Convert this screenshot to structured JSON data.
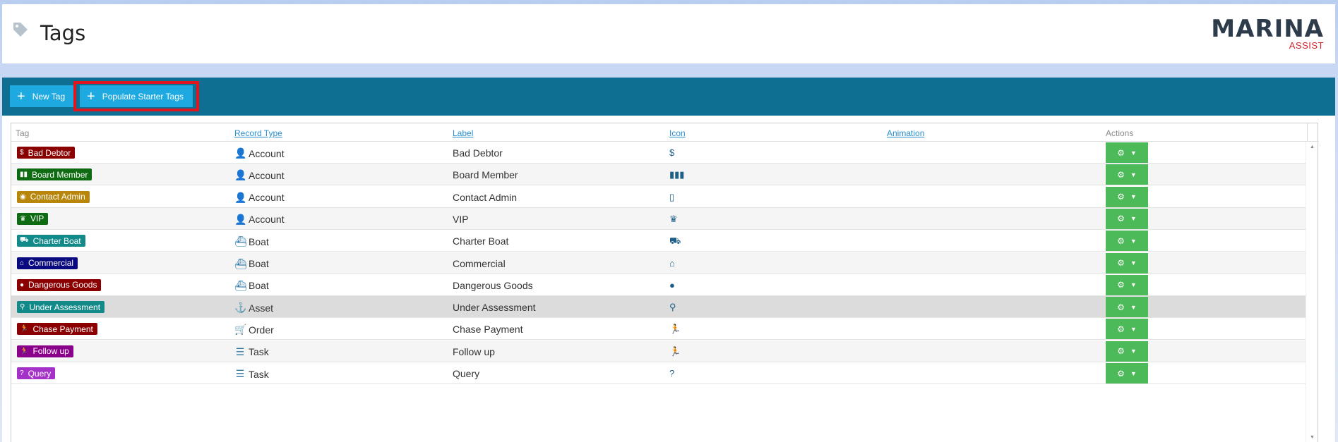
{
  "page": {
    "title": "Tags"
  },
  "logo": {
    "line1": "MARINA",
    "line2": "ASSIST"
  },
  "toolbar": {
    "new_tag_label": "New Tag",
    "populate_label": "Populate Starter Tags"
  },
  "table": {
    "columns": [
      "Tag",
      "Record Type",
      "Label",
      "Icon",
      "Animation",
      "Actions"
    ],
    "rows": [
      {
        "tag": "Bad Debtor",
        "tag_color": "#8b0000",
        "tag_icon": "hand-money-icon",
        "record_type": "Account",
        "record_icon": "user-icon",
        "label": "Bad Debtor",
        "icon_glyph": "$",
        "selected": false
      },
      {
        "tag": "Board Member",
        "tag_color": "#0e6b12",
        "tag_icon": "boardroom-icon",
        "record_type": "Account",
        "record_icon": "user-icon",
        "label": "Board Member",
        "icon_glyph": "▮▮▮",
        "selected": false
      },
      {
        "tag": "Contact Admin",
        "tag_color": "#b8860b",
        "tag_icon": "phone-icon",
        "record_type": "Account",
        "record_icon": "user-icon",
        "label": "Contact Admin",
        "icon_glyph": "▯",
        "selected": false
      },
      {
        "tag": "VIP",
        "tag_color": "#0e6b12",
        "tag_icon": "crown-icon",
        "record_type": "Account",
        "record_icon": "user-icon",
        "label": "VIP",
        "icon_glyph": "♛",
        "selected": false
      },
      {
        "tag": "Charter Boat",
        "tag_color": "#138a8a",
        "tag_icon": "truck-icon",
        "record_type": "Boat",
        "record_icon": "ship-icon",
        "label": "Charter Boat",
        "icon_glyph": "⛟",
        "selected": false
      },
      {
        "tag": "Commercial",
        "tag_color": "#0a0a80",
        "tag_icon": "warehouse-icon",
        "record_type": "Boat",
        "record_icon": "ship-icon",
        "label": "Commercial",
        "icon_glyph": "⌂",
        "selected": false
      },
      {
        "tag": "Dangerous Goods",
        "tag_color": "#8b0000",
        "tag_icon": "bomb-icon",
        "record_type": "Boat",
        "record_icon": "ship-icon",
        "label": "Dangerous Goods",
        "icon_glyph": "●",
        "selected": false
      },
      {
        "tag": "Under Assessment",
        "tag_color": "#138a8a",
        "tag_icon": "search-icon",
        "record_type": "Asset",
        "record_icon": "anchor-icon",
        "label": "Under Assessment",
        "icon_glyph": "⚲",
        "selected": true
      },
      {
        "tag": "Chase Payment",
        "tag_color": "#8b0000",
        "tag_icon": "running-icon",
        "record_type": "Order",
        "record_icon": "cart-icon",
        "label": "Chase Payment",
        "icon_glyph": "🏃",
        "selected": false
      },
      {
        "tag": "Follow up",
        "tag_color": "#8b008b",
        "tag_icon": "running-icon",
        "record_type": "Task",
        "record_icon": "tasks-icon",
        "label": "Follow up",
        "icon_glyph": "🏃",
        "selected": false
      },
      {
        "tag": "Query",
        "tag_color": "#a532c8",
        "tag_icon": "question-icon",
        "record_type": "Task",
        "record_icon": "tasks-icon",
        "label": "Query",
        "icon_glyph": "?",
        "selected": false
      }
    ]
  },
  "colors": {
    "toolbar": "#0e6f92",
    "button": "#1ea9e0",
    "action_button": "#4cba58",
    "highlight": "#e0151e"
  }
}
